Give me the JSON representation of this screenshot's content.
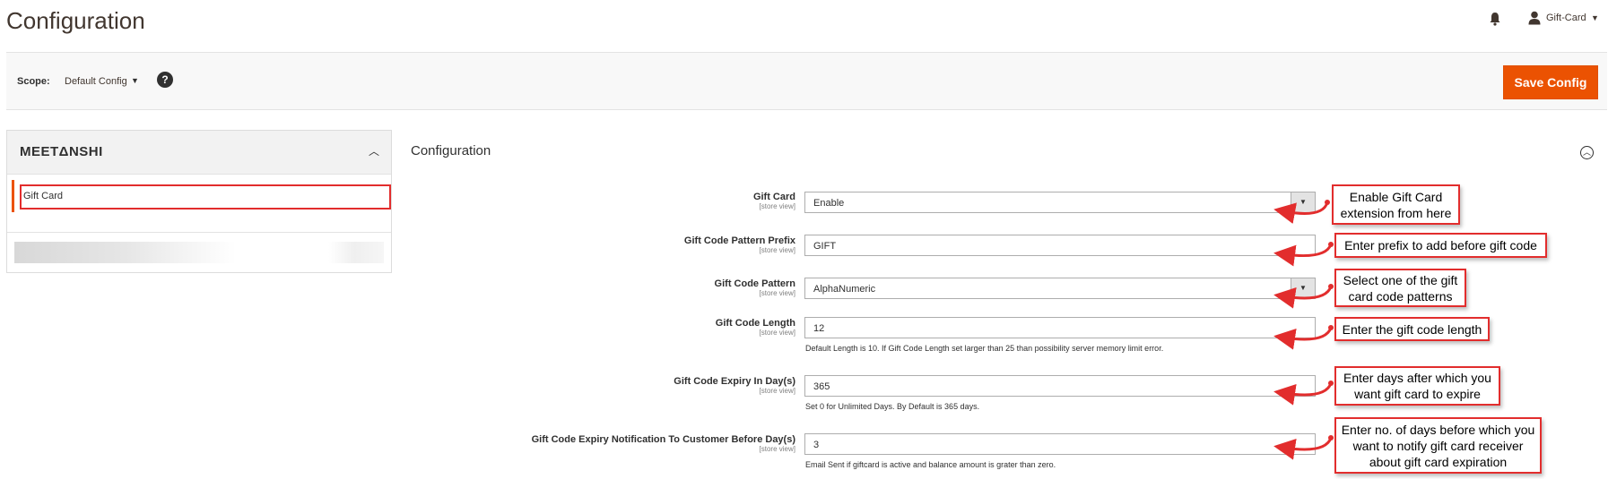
{
  "header": {
    "title": "Configuration",
    "user_name": "Gift-Card"
  },
  "toolbar": {
    "scope_label": "Scope:",
    "scope_value": "Default Config",
    "help_label": "?",
    "save_label": "Save Config"
  },
  "sidebar": {
    "brand": "MEETΔNSHI",
    "items": [
      {
        "label": "Gift Card"
      }
    ]
  },
  "section": {
    "title": "Configuration",
    "fields": [
      {
        "label": "Gift Card",
        "scope": "[store view]",
        "value": "Enable",
        "type": "select",
        "note": ""
      },
      {
        "label": "Gift Code Pattern Prefix",
        "scope": "[store view]",
        "value": "GIFT",
        "type": "text",
        "note": ""
      },
      {
        "label": "Gift Code Pattern",
        "scope": "[store view]",
        "value": "AlphaNumeric",
        "type": "select",
        "note": ""
      },
      {
        "label": "Gift Code Length",
        "scope": "[store view]",
        "value": "12",
        "type": "text",
        "note": "Default Length is 10. If Gift Code Length set larger than 25 than possibility server memory limit error."
      },
      {
        "label": "Gift Code Expiry In Day(s)",
        "scope": "[store view]",
        "value": "365",
        "type": "text",
        "note": "Set 0 for Unlimited Days. By Default is 365 days."
      },
      {
        "label": "Gift Code Expiry Notification To Customer Before Day(s)",
        "scope": "[store view]",
        "value": "3",
        "type": "text",
        "note": "Email Sent if giftcard is active and balance amount is grater than zero."
      }
    ]
  },
  "callouts": [
    {
      "line1": "Enable Gift Card",
      "line2": "extension from here",
      "line3": ""
    },
    {
      "line1": "Enter prefix to add before gift code",
      "line2": "",
      "line3": ""
    },
    {
      "line1": "Select one of the gift",
      "line2": "card code patterns",
      "line3": ""
    },
    {
      "line1": "Enter the gift code length",
      "line2": "",
      "line3": ""
    },
    {
      "line1": "Enter days after which you",
      "line2": "want gift card to expire",
      "line3": ""
    },
    {
      "line1": "Enter no. of days before which you",
      "line2": "want to notify gift card receiver",
      "line3": "about gift card expiration"
    }
  ],
  "colors": {
    "accent": "#eb5202",
    "callout_border": "#e22d2d",
    "arrow": "#e22d2d"
  },
  "icons": {
    "bell": "bell-icon",
    "user": "user-icon",
    "help": "help-icon",
    "collapse": "chevron-up-icon",
    "section_toggle": "collapse-circle-icon",
    "dropdown": "caret-down-icon"
  }
}
